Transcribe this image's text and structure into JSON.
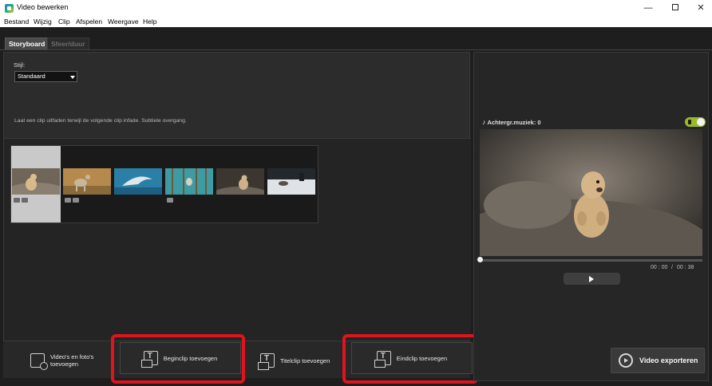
{
  "window": {
    "title": "Video bewerken",
    "minimize_glyph": "—",
    "close_glyph": "✕"
  },
  "menu": [
    "Bestand",
    "Wijzig",
    "Clip",
    "Afspelen",
    "Weergave",
    "Help"
  ],
  "tabs": [
    {
      "label": "Storyboard",
      "active": true
    },
    {
      "label": "Sfeer/duur",
      "active": false
    }
  ],
  "style": {
    "label": "Stijl:",
    "selected": "Standaard",
    "description": "Laat een clip uitfaden terwijl de volgende clip infade. Subtiele overgang."
  },
  "clips": [
    {
      "subject": "prairie-dog",
      "selected": true,
      "badges": [
        "video-icon",
        "photo-icon"
      ]
    },
    {
      "subject": "deer",
      "selected": false,
      "badges": [
        "video-icon",
        "photo-icon"
      ]
    },
    {
      "subject": "dolphin",
      "selected": false,
      "badges": []
    },
    {
      "subject": "bird-in-reeds",
      "selected": false,
      "badges": [
        "video-icon"
      ]
    },
    {
      "subject": "prairie-dog-2",
      "selected": false,
      "badges": []
    },
    {
      "subject": "snowy-field",
      "selected": false,
      "badges": []
    }
  ],
  "bottom_buttons": {
    "add_media_line1": "Video's en foto's",
    "add_media_line2": "toevoegen",
    "add_opening": "Beginclip toevoegen",
    "add_title": "Titelclip toevoegen",
    "add_ending": "Eindclip toevoegen"
  },
  "music": {
    "label": "Achtergr.muziek: 0",
    "enabled": true
  },
  "player": {
    "current_time": "00 : 00",
    "separator": "/",
    "total_time": "00 : 38",
    "progress": 0
  },
  "export": {
    "label": "Video exporteren"
  },
  "colors": {
    "highlight": "#e0141e",
    "toggle_on": "#9ab92a",
    "panel_bg": "#2c2c2c"
  }
}
